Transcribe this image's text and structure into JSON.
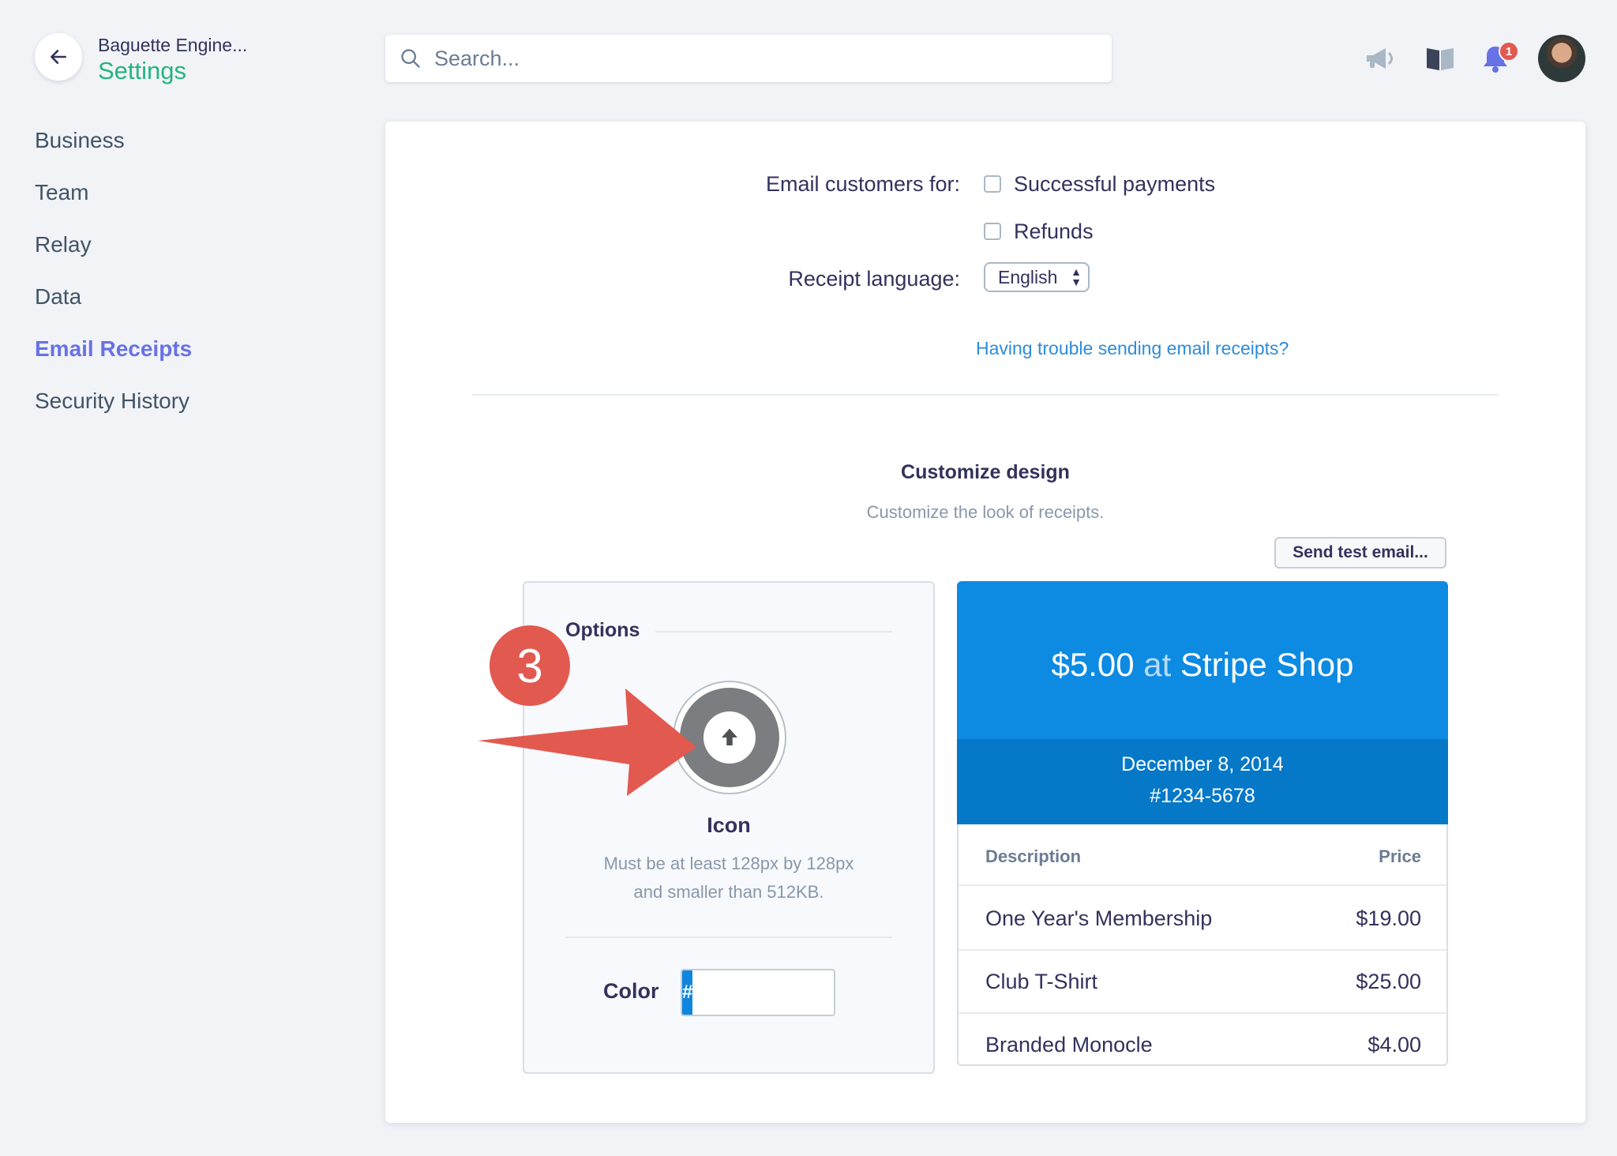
{
  "header": {
    "account_name": "Baguette Engine...",
    "page_title": "Settings",
    "search_placeholder": "Search...",
    "notification_count": "1"
  },
  "sidebar": {
    "items": [
      {
        "label": "Business"
      },
      {
        "label": "Team"
      },
      {
        "label": "Relay"
      },
      {
        "label": "Data"
      },
      {
        "label": "Email Receipts",
        "active": true
      },
      {
        "label": "Security History"
      }
    ]
  },
  "settings": {
    "email_customers_label": "Email customers for:",
    "option_successful_payments": "Successful payments",
    "option_refunds": "Refunds",
    "receipt_language_label": "Receipt language:",
    "receipt_language_value": "English",
    "trouble_link": "Having trouble sending email receipts?"
  },
  "design": {
    "title": "Customize design",
    "subtitle": "Customize the look of receipts.",
    "send_test_button": "Send test email...",
    "options_title": "Options",
    "icon_title": "Icon",
    "icon_help_line1": "Must be at least 128px by 128px",
    "icon_help_line2": "and smaller than 512KB.",
    "color_label": "Color",
    "color_prefix": "#",
    "step_number": "3"
  },
  "receipt": {
    "amount": "$5.00",
    "at": "at",
    "shop": "Stripe Shop",
    "date": "December 8, 2014",
    "number": "#1234-5678",
    "col_description": "Description",
    "col_price": "Price",
    "items": [
      {
        "description": "One Year's Membership",
        "price": "$19.00"
      },
      {
        "description": "Club T-Shirt",
        "price": "$25.00"
      },
      {
        "description": "Branded Monocle",
        "price": "$4.00"
      }
    ]
  },
  "colors": {
    "accent_green": "#24b47e",
    "accent_purple": "#6772e5",
    "receipt_blue": "#0d8ae2",
    "annotation_red": "#e25950"
  }
}
